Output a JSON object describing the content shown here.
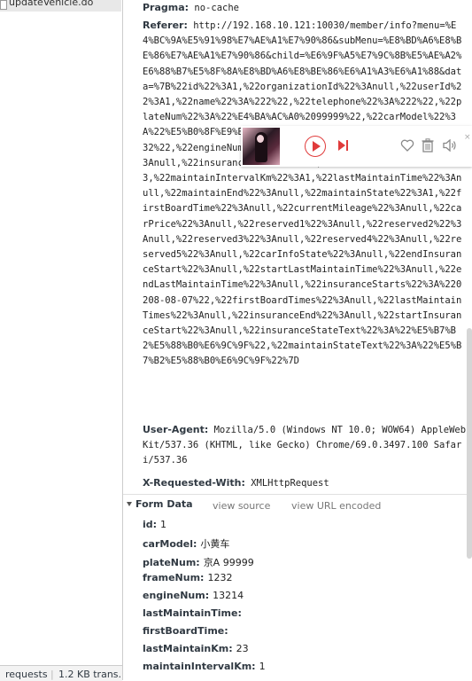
{
  "request_list": {
    "item_name": "updateVehicle.do"
  },
  "status_bar": {
    "requests": "requests",
    "transferred": "1.2 KB trans..."
  },
  "headers": {
    "pragma_key": "Pragma:",
    "pragma_value": "no-cache",
    "referer_key": "Referer:",
    "referer_value": "http://192.168.10.121:10030/member/info?menu=%E4%BC%9A%E5%91%98%E7%AE%A1%E7%90%86&subMenu=%E8%BD%A6%E8%BE%86%E7%AE%A1%E7%90%86&child=%E6%9F%A5%E7%9C%8B%E5%AE%A2%E6%88%B7%E5%8F%8A%E8%BD%A6%E8%BE%86%E6%A1%A3%E6%A1%88&data=%7B%22id%22%3A1,%22organizationId%22%3Anull,%22userId%22%3A1,%22name%22%3A%222%22,%22telephone%22%3A%222%22,%22plateNum%22%3A%22%E4%BA%AC%A0%2099999%22,%22carModel%22%3A%22%E5%B0%8F%E9%BB%84%E8%BD%A6%22,%22frameNum%22%3A%221232%22,%22engineNum%22%3A%2213214%22,%22insuranceStart%22%3Anull,%22insuranceState%22%3A1,%22lastMaintainKm%22%3A23,%22maintainIntervalKm%22%3A1,%22lastMaintainTime%22%3Anull,%22maintainEnd%22%3Anull,%22maintainState%22%3A1,%22firstBoardTime%22%3Anull,%22currentMileage%22%3Anull,%22carPrice%22%3Anull,%22reserved1%22%3Anull,%22reserved2%22%3Anull,%22reserved3%22%3Anull,%22reserved4%22%3Anull,%22reserved5%22%3Anull,%22carInfoState%22%3Anull,%22endInsuranceStart%22%3Anull,%22startLastMaintainTime%22%3Anull,%22endLastMaintainTime%22%3Anull,%22insuranceStarts%22%3A%220208-08-07%22,%22firstBoardTimes%22%3Anull,%22lastMaintainTimes%22%3Anull,%22insuranceEnd%22%3Anull,%22startInsuranceStart%22%3Anull,%22insuranceStateText%22%3A%22%E5%B7%B2%E5%88%B0%E6%9C%9F%22,%22maintainStateText%22%3A%22%E5%B7%B2%E5%88%B0%E6%9C%9F%22%7D",
    "ua_key": "User-Agent:",
    "ua_value": "Mozilla/5.0 (Windows NT 10.0; WOW64) AppleWebKit/537.36 (KHTML, like Gecko) Chrome/69.0.3497.100 Safari/537.36",
    "xrw_key": "X-Requested-With:",
    "xrw_value": "XMLHttpRequest"
  },
  "form_data": {
    "title": "Form Data",
    "view_source": "view source",
    "view_url_encoded": "view URL encoded",
    "rows": [
      {
        "key": "id:",
        "value": "1"
      },
      {
        "key": "carModel:",
        "value": "小黄车"
      },
      {
        "key": "plateNum:",
        "value": "京A  99999"
      },
      {
        "key": "frameNum:",
        "value": "1232"
      },
      {
        "key": "engineNum:",
        "value": "13214"
      },
      {
        "key": "lastMaintainTime:",
        "value": ""
      },
      {
        "key": "firstBoardTime:",
        "value": ""
      },
      {
        "key": "lastMaintainKm:",
        "value": "23"
      },
      {
        "key": "maintainIntervalKm:",
        "value": "1"
      }
    ]
  },
  "player": {
    "close_glyph": "×",
    "accent_color": "#e03b3b"
  }
}
